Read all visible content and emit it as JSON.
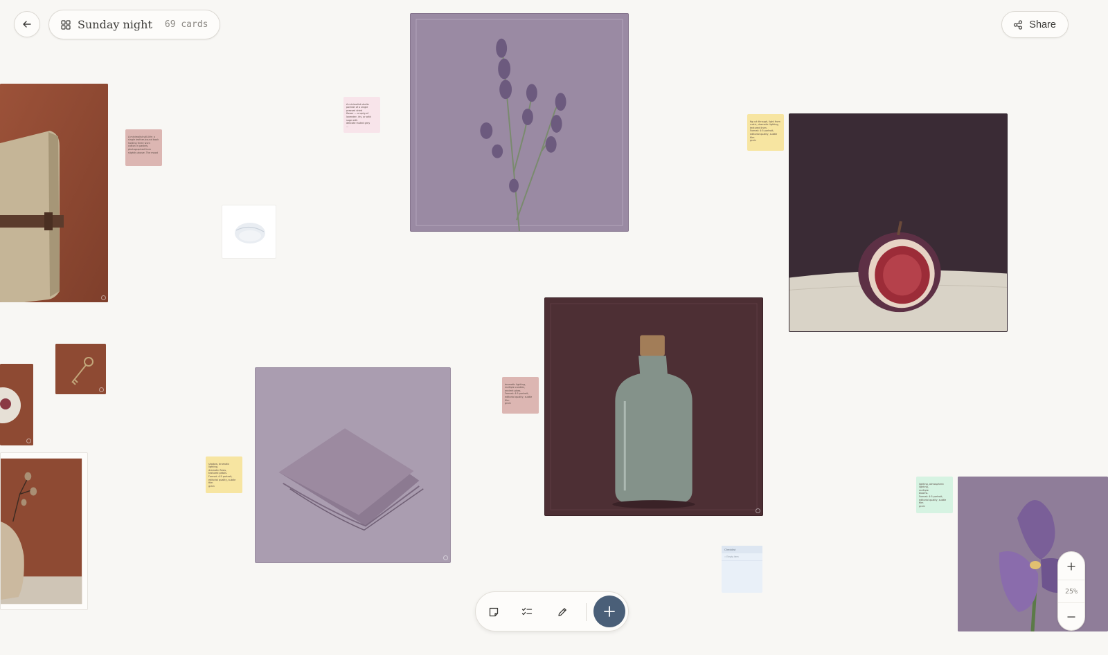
{
  "board": {
    "back_label": "Back",
    "title": "Sunday night",
    "card_count": "69 cards"
  },
  "share": {
    "label": "Share"
  },
  "notes": [
    {
      "id": "note-rust",
      "color": "#dcb6b2",
      "lines": [
        "A minimalist still-life: a",
        "single leather-bound book",
        "holding three worn",
        "cotton in pastels,",
        "photographed from",
        "slightly above. The mood"
      ]
    },
    {
      "id": "note-pink",
      "color": "#f8e4ea",
      "lines": [
        "A minimalist studio",
        "portrait of a single",
        "pressed dried",
        "flower — a sprig of",
        "lavender, iris, or wild",
        "sage with",
        "delicate muted grey",
        "..."
      ]
    },
    {
      "id": "note-yellow-top",
      "color": "#f7e5a1",
      "lines": [
        "fig cut through, light from",
        "rustic, dramatic lighting,",
        "textured linen.",
        "",
        "Format: 4:5 portrait,",
        "editorial quality, subtle",
        "film",
        "grain"
      ]
    },
    {
      "id": "note-rose-mid",
      "color": "#dcb6b2",
      "lines": [
        "dramatic lighting,",
        "multiple candles,",
        "ancient glass.",
        "",
        "Format: 4:5 portrait,",
        "editorial quality, subtle",
        "film",
        "grain"
      ]
    },
    {
      "id": "note-yellow-bottom",
      "color": "#f7e5a1",
      "lines": [
        "shadow, dramatic lighting,",
        "dramatic flows,",
        "textured petals.",
        "",
        "Format: 4:5 portrait,",
        "editorial quality, subtle",
        "film",
        "grain"
      ]
    },
    {
      "id": "note-mint",
      "color": "#d6f3e2",
      "lines": [
        "lighting, atmospheric lighting,",
        "multiple",
        "blooms.",
        "",
        "Format: 4:5 portrait,",
        "editorial quality, subtle",
        "film",
        "grain"
      ]
    }
  ],
  "checklist": {
    "title": "Checklist",
    "placeholder": "Empty item"
  },
  "toolbar": {
    "note_tool": "note-icon",
    "checklist_tool": "checklist-icon",
    "draw_tool": "pencil-icon",
    "add": "plus-icon"
  },
  "zoom": {
    "level": "25%"
  },
  "colors": {
    "background": "#f8f7f4",
    "accent": "#4a5f78",
    "rust": "#8e4a33",
    "lavender": "#9a8aa3",
    "plum": "#3a2b35",
    "wine": "#4d2f34"
  }
}
